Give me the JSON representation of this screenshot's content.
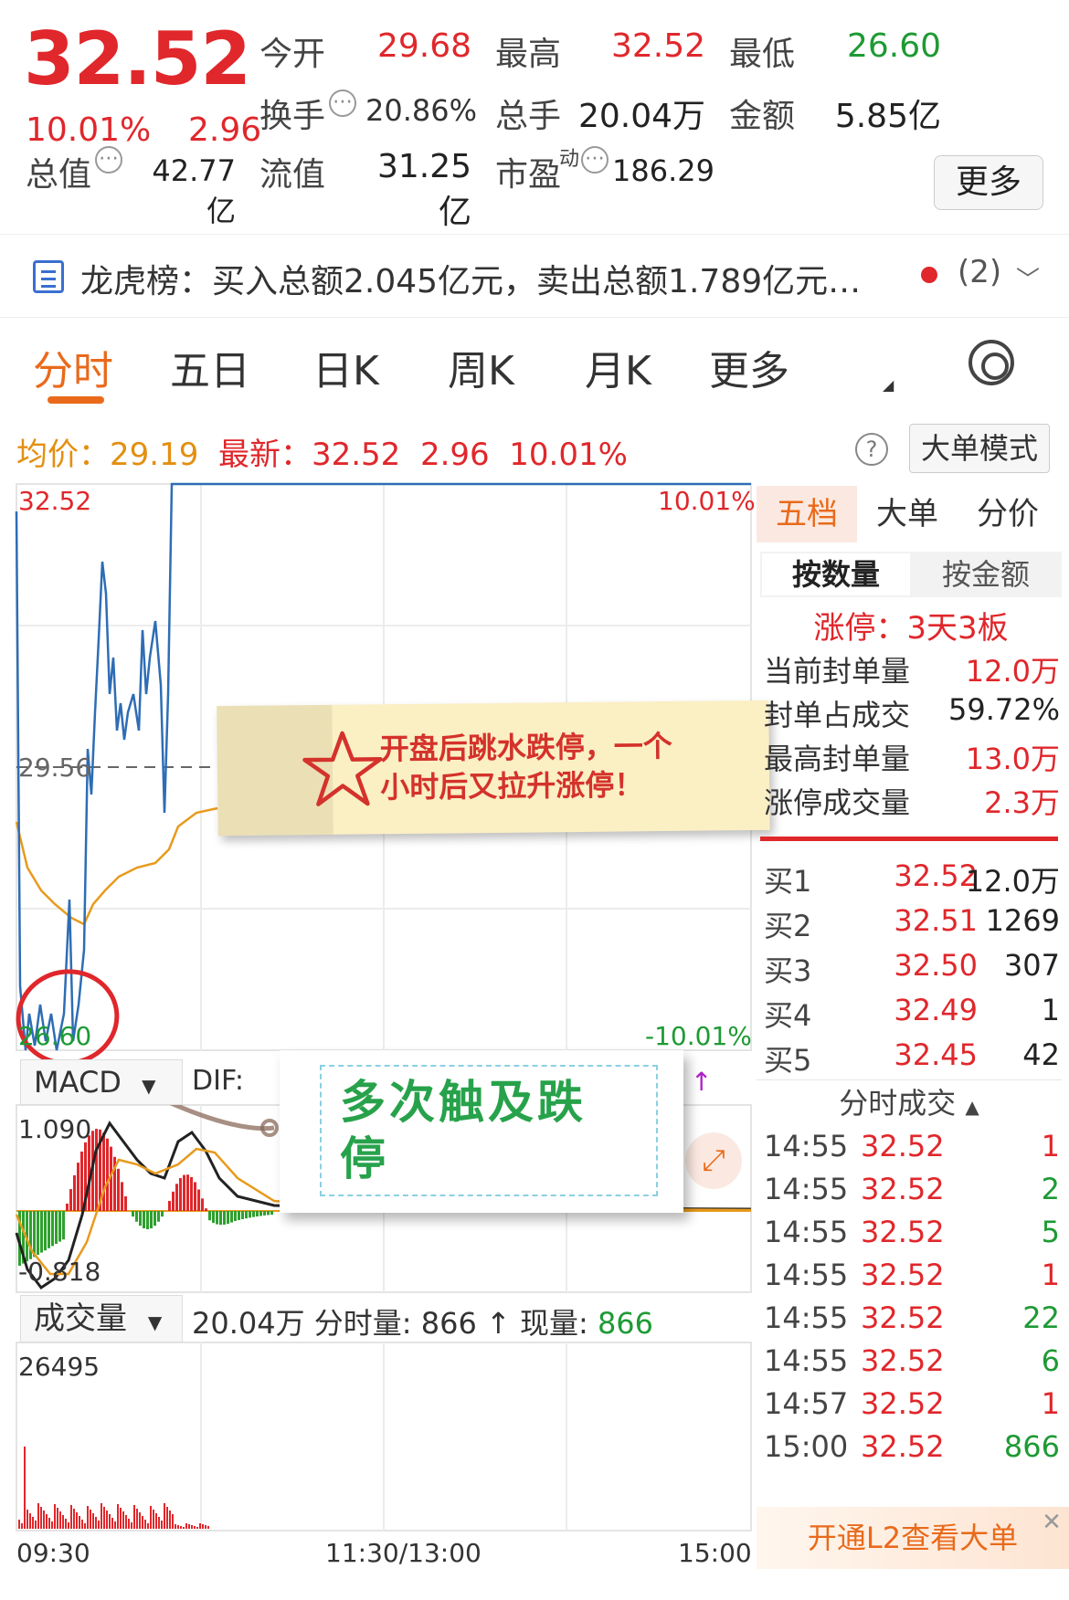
{
  "quote": {
    "price": "32.52",
    "change_pct": "10.01%",
    "change": "2.96",
    "open_label": "今开",
    "open": "29.68",
    "high_label": "最高",
    "high": "32.52",
    "low_label": "最低",
    "low": "26.60",
    "turnover_label": "换手",
    "turnover": "20.86%",
    "volume_label": "总手",
    "volume": "20.04万",
    "amount_label": "金额",
    "amount": "5.85亿",
    "mktcap_label": "总值",
    "mktcap": "42.77亿",
    "float_label": "流值",
    "float": "31.25亿",
    "pe_label": "市盈",
    "pe_sup": "动",
    "pe": "186.29",
    "more_label": "更多",
    "colors": {
      "up": "#e0272b",
      "down": "#1e9a34"
    }
  },
  "banner": {
    "text": "龙虎榜：买入总额2.045亿元，卖出总额1.789亿元…",
    "count": "(2)",
    "icon": "document-icon",
    "chevron": "chevron-down-icon"
  },
  "tabs": [
    "分时",
    "五日",
    "日K",
    "周K",
    "月K",
    "更多"
  ],
  "active_tab": "分时",
  "avg_line": {
    "avg_label": "均价：",
    "avg": "29.19",
    "latest_label": "最新：",
    "latest": "32.52",
    "change": "2.96",
    "pct": "10.01%",
    "mode_btn": "大单模式",
    "help": "?"
  },
  "chart": {
    "y_top": "32.52",
    "y_mid": "29.56",
    "y_bottom": "26.60",
    "pct_top": "10.01%",
    "pct_bottom": "-10.01%",
    "x_start": "09:30",
    "x_mid": "11:30/13:00",
    "x_end": "15:00",
    "macd_select": "MACD",
    "macd_arrow": "▼",
    "dif_label": "DIF:",
    "macd_top": "1.090",
    "macd_bottom": "-0.818",
    "vol_select": "成交量",
    "vol_info": "20.04万 分时量: 866 ↑ 现量: ",
    "vol_now": "866",
    "vol_top": "26495",
    "expand_icon": "expand-icon"
  },
  "chart_data": {
    "type": "line",
    "x_range": [
      "09:30",
      "15:00"
    ],
    "ylim": [
      26.6,
      32.52
    ],
    "series": [],
    "colors": {
      "price": "#2e6db5",
      "avg": "#e89a1d",
      "macd_up": "#e0272b",
      "macd_down": "#2ea02e"
    }
  },
  "notes": {
    "note1": "开盘后跳水跌停，一个\n小时后又拉升涨停！",
    "note2": "多次触及跌\n停"
  },
  "side": {
    "tabs": [
      "五档",
      "大单",
      "分价"
    ],
    "sub_tabs": [
      "按数量",
      "按金额"
    ],
    "limit_title": "涨停：3天3板",
    "stats": [
      {
        "k": "当前封单量",
        "v": "12.0万"
      },
      {
        "k": "封单占成交",
        "v": "59.72%"
      },
      {
        "k": "最高封单量",
        "v": "13.0万"
      },
      {
        "k": "涨停成交量",
        "v": "2.3万"
      }
    ],
    "bids": [
      {
        "k": "买1",
        "p": "32.52",
        "q": "12.0万"
      },
      {
        "k": "买2",
        "p": "32.51",
        "q": "1269"
      },
      {
        "k": "买3",
        "p": "32.50",
        "q": "307"
      },
      {
        "k": "买4",
        "p": "32.49",
        "q": "1"
      },
      {
        "k": "买5",
        "p": "32.45",
        "q": "42"
      }
    ],
    "tick_head": "分时成交",
    "ticks": [
      {
        "t": "14:55",
        "p": "32.52",
        "q": "1"
      },
      {
        "t": "14:55",
        "p": "32.52",
        "q": "2"
      },
      {
        "t": "14:55",
        "p": "32.52",
        "q": "5"
      },
      {
        "t": "14:55",
        "p": "32.52",
        "q": "1"
      },
      {
        "t": "14:55",
        "p": "32.52",
        "q": "22"
      },
      {
        "t": "14:55",
        "p": "32.52",
        "q": "6"
      },
      {
        "t": "14:57",
        "p": "32.52",
        "q": "1"
      },
      {
        "t": "15:00",
        "p": "32.52",
        "q": "866"
      }
    ],
    "l2_banner": "开通L2查看大单",
    "l2_close": "✕"
  }
}
